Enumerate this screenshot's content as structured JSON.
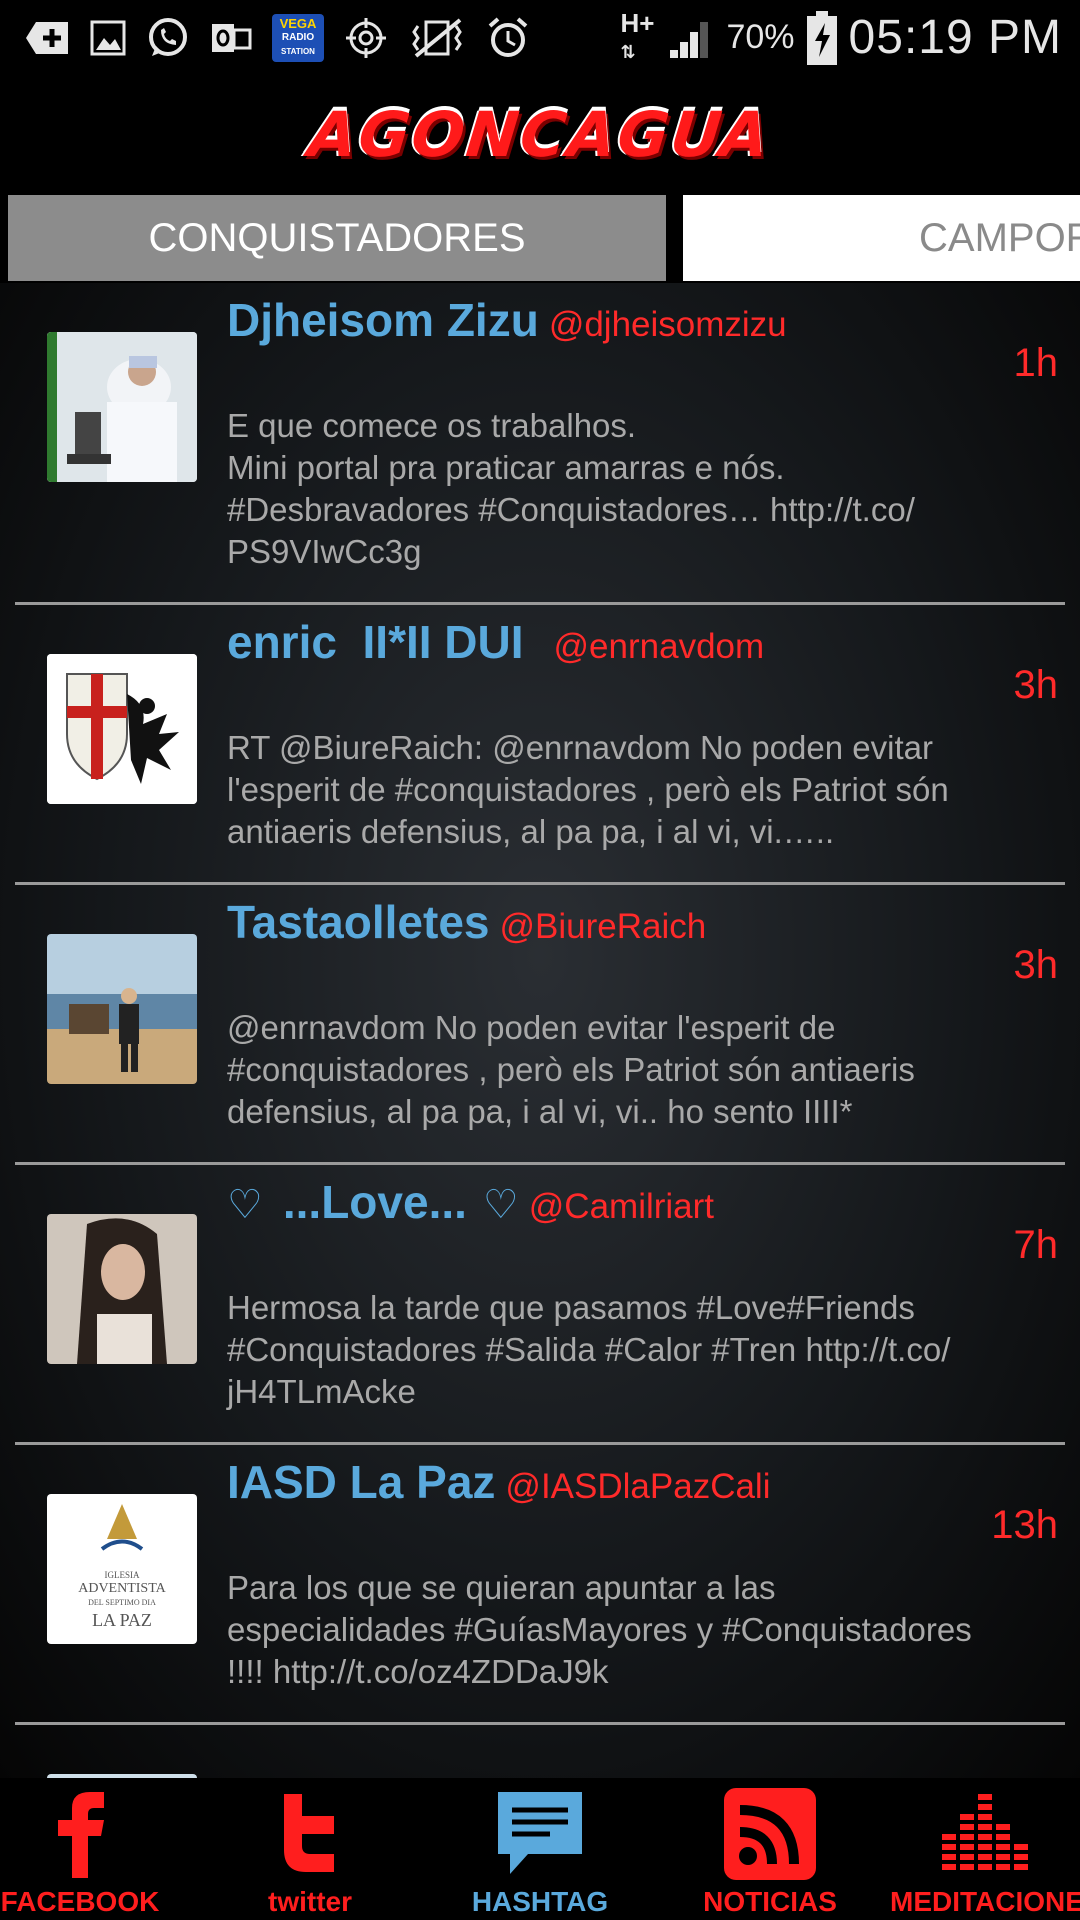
{
  "status_bar": {
    "icons_left": [
      "add-icon",
      "image-icon",
      "whatsapp-icon",
      "outlook-icon",
      "vega-radio-icon",
      "gps-icon",
      "vibrate-mute-icon",
      "alarm-icon"
    ],
    "vega_label_top": "VEGA",
    "vega_label_mid": "RADIO",
    "vega_label_bottom": "STATION",
    "network": "H+",
    "battery": "70%",
    "time": "05:19 PM"
  },
  "header": {
    "logo_text": "AGONCAGUA"
  },
  "tabs": [
    {
      "label": "CONQUISTADORES",
      "active": true
    },
    {
      "label": "CAMPOR",
      "active": false
    }
  ],
  "tweets": [
    {
      "name": "Djheisom Zizu",
      "handle": "@djheisomzizu",
      "time": "1h",
      "text": "E que comece os trabalhos.\nMini portal pra praticar amarras e nós.\n#Desbravadores #Conquistadores… http://t.co/\nPS9VIwCc3g"
    },
    {
      "name": "enric  II*II DUI",
      "handle": "@enrnavdom",
      "time": "3h",
      "text": "RT @BiureRaich: @enrnavdom No poden evitar\nl'esperit de #conquistadores , però els Patriot són\nantiaeris defensius, al pa pa, i al vi, vi.….."
    },
    {
      "name": "Tastaolletes",
      "handle": "@BiureRaich",
      "time": "3h",
      "text": "@enrnavdom No poden evitar l'esperit de\n#conquistadores , però els Patriot són antiaeris\ndefensius, al pa pa, i al vi, vi.. ho sento IIII*"
    },
    {
      "name": "...Love...",
      "handle": "@Camilriart",
      "time": "7h",
      "text": "Hermosa la tarde que pasamos #Love#Friends\n#Conquistadores #Salida #Calor #Tren http://t.co/\njH4TLmAcke"
    },
    {
      "name": "IASD La Paz",
      "handle": "@IASDlaPazCali",
      "time": "13h",
      "text": "Para los que se quieran apuntar a las\nespecialidades #GuíasMayores y #Conquistadores\n!!!! http://t.co/oz4ZDDaJ9k"
    }
  ],
  "avatar5_text": {
    "line1": "IGLESIA",
    "line2": "ADVENTISTA",
    "line3": "DEL SEPTIMO DIA",
    "line4": "LA PAZ"
  },
  "bottom_nav": [
    {
      "label": "FACEBOOK",
      "icon": "facebook-icon",
      "color": "#ff1e1e",
      "active": false
    },
    {
      "label": "twitter",
      "icon": "twitter-icon",
      "color": "#ff1e1e",
      "active": false
    },
    {
      "label": "HASHTAG",
      "icon": "chat-bubble-icon",
      "color": "#5aa9dc",
      "active": true
    },
    {
      "label": "NOTICIAS",
      "icon": "rss-icon",
      "color": "#ff1e1e",
      "active": false
    },
    {
      "label": "MEDITACIONE",
      "icon": "equalizer-icon",
      "color": "#ff1e1e",
      "active": false
    }
  ]
}
